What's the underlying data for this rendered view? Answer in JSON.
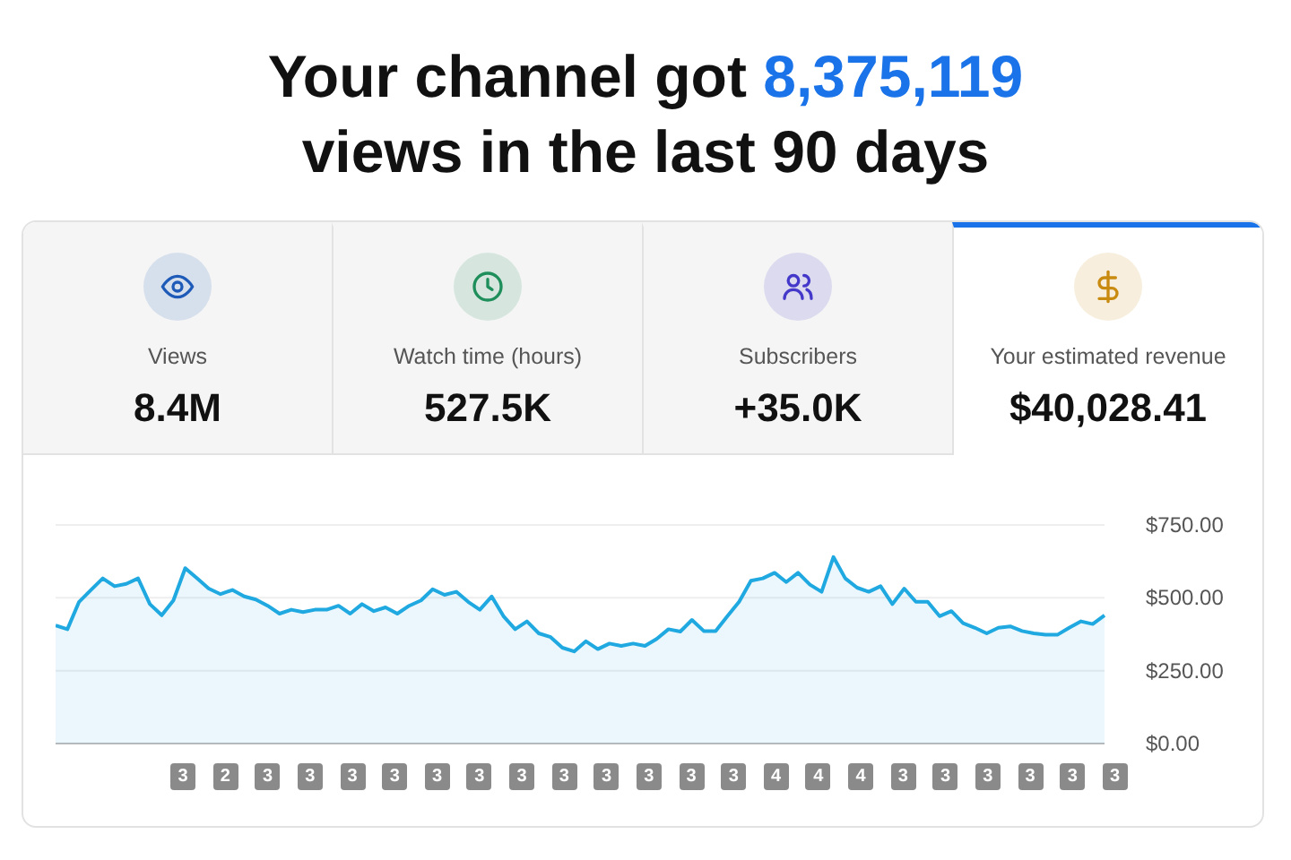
{
  "headline": {
    "before": "Your channel got ",
    "highlight": "8,375,119",
    "after": " views in the last 90 days"
  },
  "tabs": [
    {
      "kind": "eye",
      "color": "#1e5bb8",
      "label": "Views",
      "value": "8.4M",
      "selected": false
    },
    {
      "kind": "clock",
      "color": "#1e8e5a",
      "label": "Watch time (hours)",
      "value": "527.5K",
      "selected": false
    },
    {
      "kind": "users",
      "color": "#4338ca",
      "label": "Subscribers",
      "value": "+35.0K",
      "selected": false
    },
    {
      "kind": "dollar",
      "color": "#c98a10",
      "label": "Your estimated revenue",
      "value": "$40,028.41",
      "selected": true
    }
  ],
  "chart": {
    "chart_data": {
      "type": "area",
      "ylim": [
        0,
        750
      ],
      "yticks": [
        {
          "value": 0,
          "label": "$0.00"
        },
        {
          "value": 250,
          "label": "$250.00"
        },
        {
          "value": 500,
          "label": "$500.00"
        },
        {
          "value": 750,
          "label": "$750.00"
        }
      ],
      "series": [
        {
          "color": "#1fa9e0",
          "values": [
            405,
            392,
            486,
            527,
            567,
            540,
            548,
            567,
            478,
            440,
            491,
            602,
            567,
            532,
            513,
            527,
            505,
            494,
            473,
            446,
            459,
            451,
            459,
            459,
            473,
            446,
            478,
            454,
            467,
            446,
            473,
            491,
            529,
            510,
            521,
            486,
            459,
            505,
            437,
            392,
            419,
            378,
            365,
            329,
            316,
            351,
            324,
            343,
            335,
            343,
            335,
            359,
            392,
            384,
            424,
            386,
            386,
            437,
            486,
            559,
            567,
            586,
            554,
            586,
            545,
            521,
            640,
            567,
            535,
            521,
            540,
            478,
            532,
            486,
            486,
            437,
            454,
            413,
            397,
            378,
            397,
            402,
            386,
            378,
            373,
            373,
            397,
            419,
            410,
            440
          ]
        }
      ]
    }
  },
  "badges": [
    "3",
    "2",
    "3",
    "3",
    "3",
    "3",
    "3",
    "3",
    "3",
    "3",
    "3",
    "3",
    "3",
    "3",
    "4",
    "4",
    "4",
    "3",
    "3",
    "3",
    "3",
    "3",
    "3"
  ]
}
